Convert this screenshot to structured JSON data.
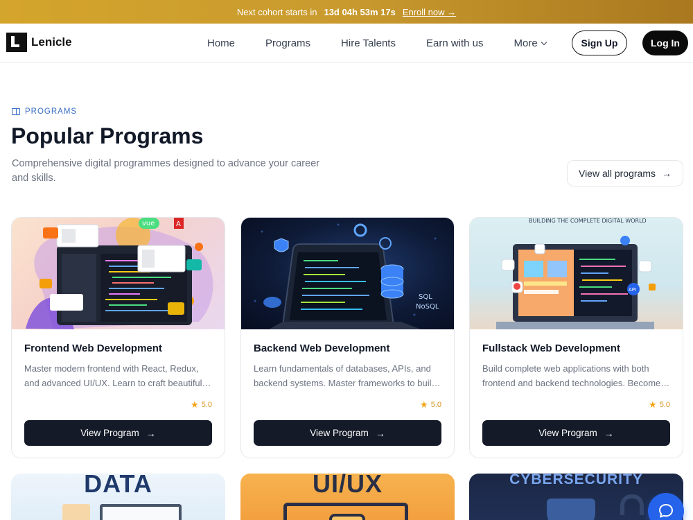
{
  "banner": {
    "prefix": "Next cohort starts in",
    "countdown": "13d 04h 53m 17s",
    "cta": "Enroll now →"
  },
  "brand": {
    "name": "Lenicle"
  },
  "nav": {
    "items": [
      {
        "label": "Home"
      },
      {
        "label": "Programs"
      },
      {
        "label": "Hire Talents"
      },
      {
        "label": "Earn with us"
      },
      {
        "label": "More"
      }
    ],
    "signup": "Sign Up",
    "login": "Log In"
  },
  "section": {
    "eyebrow": "PROGRAMS",
    "title": "Popular Programs",
    "subtitle": "Comprehensive digital programmes designed to advance your career and skills.",
    "view_all": "View all programs"
  },
  "programs": [
    {
      "title": "Frontend Web Development",
      "description": "Master modern frontend with React, Redux, and advanced UI/UX. Learn to craft beautiful, responsive interfaces.",
      "rating": "5.0",
      "cta": "View Program",
      "image_labels": [
        "vue",
        "A"
      ]
    },
    {
      "title": "Backend Web Development",
      "description": "Learn fundamentals of databases, APIs, and backend systems. Master frameworks to build scalable services.",
      "rating": "5.0",
      "cta": "View Program",
      "image_labels": [
        "SQL",
        "NoSQL"
      ]
    },
    {
      "title": "Fullstack Web Development",
      "description": "Build complete web applications with both frontend and backend technologies. Become a versatile developer.",
      "rating": "5.0",
      "cta": "View Program",
      "image_labels": [
        "BUILDING THE COMPLETE DIGITAL WORLD",
        "API"
      ]
    }
  ],
  "more_programs": [
    {
      "label": "DATA"
    },
    {
      "label": "UI/UX"
    },
    {
      "label": "CYBERSECURITY"
    }
  ],
  "colors": {
    "banner": "#c99a2e",
    "accent": "#3b6fc4",
    "button_dark": "#141a27",
    "star": "#f2a516",
    "chat": "#2563eb"
  }
}
